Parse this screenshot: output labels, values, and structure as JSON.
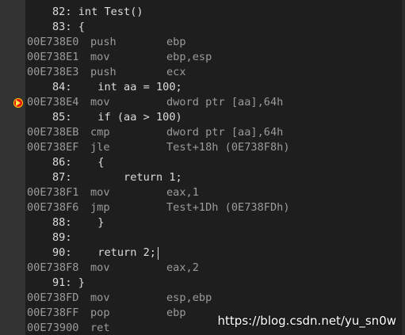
{
  "colors": {
    "background": "#1e1e1e",
    "gutter": "#333333",
    "source_text": "#dcdcdc",
    "disassembly_text": "#9b9b9b",
    "breakpoint": "#e51400"
  },
  "lines": [
    {
      "source": "82: int Test()"
    },
    {
      "source": "83: {"
    },
    {
      "addr": "00E738E0",
      "op": "push",
      "args": "ebp"
    },
    {
      "addr": "00E738E1",
      "op": "mov",
      "args": "ebp,esp"
    },
    {
      "addr": "00E738E3",
      "op": "push",
      "args": "ecx"
    },
    {
      "source": "84:    int aa = 100;"
    },
    {
      "addr": "00E738E4",
      "op": "mov",
      "args": "dword ptr [aa],64h",
      "breakpoint_icon": "current-instruction-breakpoint-icon"
    },
    {
      "source": "85:    if (aa > 100)"
    },
    {
      "addr": "00E738EB",
      "op": "cmp",
      "args": "dword ptr [aa],64h"
    },
    {
      "addr": "00E738EF",
      "op": "jle",
      "args": "Test+18h (0E738F8h)"
    },
    {
      "source": "86:    {"
    },
    {
      "source": "87:        return 1;"
    },
    {
      "addr": "00E738F1",
      "op": "mov",
      "args": "eax,1"
    },
    {
      "addr": "00E738F6",
      "op": "jmp",
      "args": "Test+1Dh (0E738FDh)"
    },
    {
      "source": "88:    }"
    },
    {
      "source": "89:"
    },
    {
      "source": "90:    return 2;",
      "caret": true
    },
    {
      "addr": "00E738F8",
      "op": "mov",
      "args": "eax,2"
    },
    {
      "source": "91: }"
    },
    {
      "addr": "00E738FD",
      "op": "mov",
      "args": "esp,ebp"
    },
    {
      "addr": "00E738FF",
      "op": "pop",
      "args": "ebp"
    },
    {
      "addr": "00E73900",
      "op": "ret",
      "args": ""
    }
  ],
  "watermark": "https://blog.csdn.net/yu_sn0w"
}
